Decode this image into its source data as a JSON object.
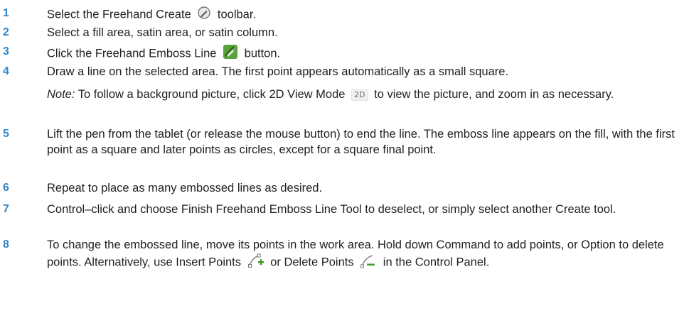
{
  "steps": [
    {
      "num": "1",
      "pre": "Select the Freehand Create",
      "icon": "freehand-create-icon",
      "post": "toolbar."
    },
    {
      "num": "2",
      "text": "Select a fill area, satin area, or satin column."
    },
    {
      "num": "3",
      "pre": "Click the Freehand Emboss Line",
      "icon": "freehand-emboss-line-icon",
      "post": "button."
    },
    {
      "num": "4",
      "text": "Draw a line on the selected area. The first point appears automatically as a small square."
    },
    {
      "num": "5",
      "text": "Lift the pen from the tablet (or release the mouse button) to end the line. The emboss line appears on the fill, with the first point as a square and later points as circles, except for a square final point."
    },
    {
      "num": "6",
      "text": "Repeat to place as many embossed lines as desired."
    },
    {
      "num": "7",
      "text": "Control–click and choose Finish Freehand Emboss Line Tool to deselect, or simply select another Create tool."
    },
    {
      "num": "8",
      "text_a": "To change the embossed line, move its points in the work area. Hold down Command to add points, or Option to delete points. Alternatively, use Insert Points",
      "icon_a": "insert-points-icon",
      "text_b": "or Delete Points",
      "icon_b": "delete-points-icon",
      "text_c": "in the Control Panel."
    }
  ],
  "note": {
    "label": "Note:",
    "pre": "To follow a background picture, click 2D View Mode",
    "chip": "2D",
    "post": "to view the picture, and zoom in as necessary."
  }
}
